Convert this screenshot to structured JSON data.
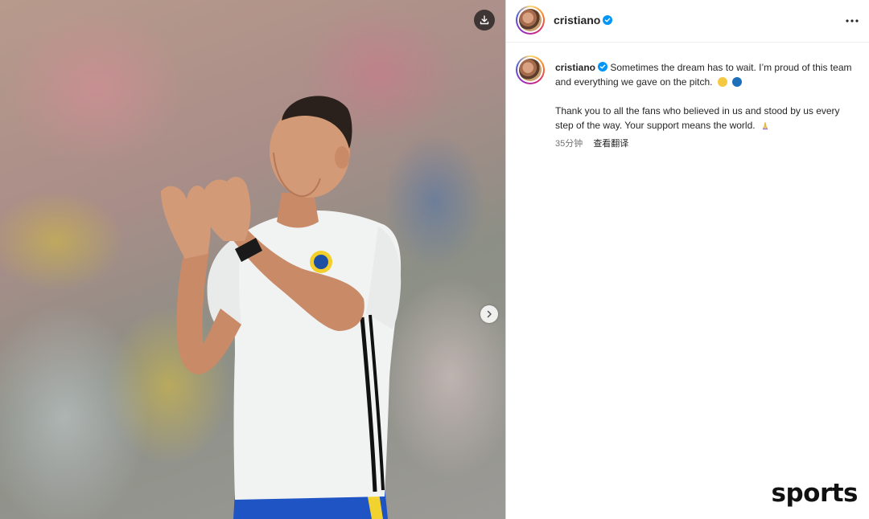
{
  "post": {
    "username": "cristiano",
    "caption_line1": "Sometimes the dream has to wait. I’m proud of this team and everything we gave on the pitch.",
    "caption_line2": "Thank you to all the fans who believed in us and stood by us every step of the way. Your support means the world.",
    "time_ago": "35分钟",
    "translate_label": "查看翻译"
  },
  "icons": {
    "verified": "verified-badge-icon",
    "more": "more-options-icon",
    "download": "download-icon",
    "next": "chevron-right-icon"
  },
  "colors": {
    "verified_blue": "#0095f6",
    "emoji_yellow": "#f5c842",
    "emoji_blue": "#1c6fb8"
  },
  "watermark": "sports"
}
